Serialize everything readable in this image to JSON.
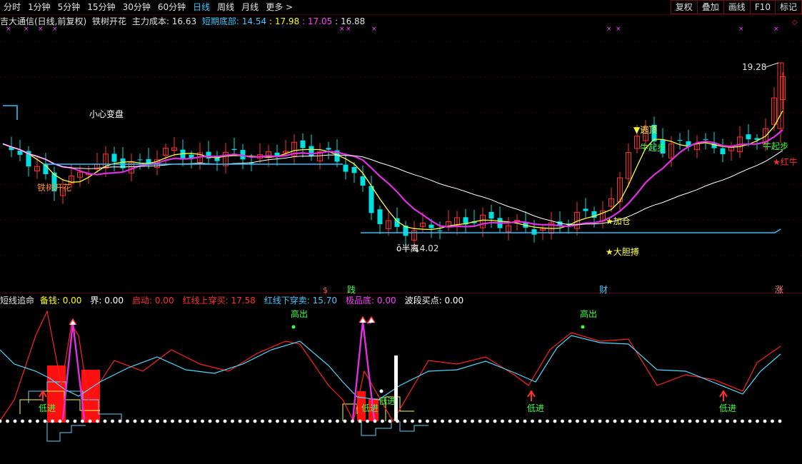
{
  "toolbar": {
    "periods": [
      "分时",
      "1分钟",
      "5分钟",
      "15分钟",
      "30分钟",
      "60分钟",
      "日线",
      "周线",
      "月线",
      "更多 >"
    ],
    "active_period": "日线",
    "buttons": [
      "复权",
      "叠加",
      "画线",
      "F10",
      "标记"
    ]
  },
  "info": {
    "stock": "吉大通信(日线,前复权)",
    "indicator": "铁树开花",
    "main_cost_label": "主力成本:",
    "main_cost": "16.63",
    "short_bottom_label": "短期底部:",
    "v1": "14.54",
    "v2": "17.98",
    "v3": "17.05",
    "v4": "16.88"
  },
  "indicator_line": {
    "name": "短线追命",
    "items": [
      {
        "label": "备钱:",
        "value": "0.00",
        "color": "#ffff00"
      },
      {
        "label": "界:",
        "value": "0.00",
        "color": "#ffffff"
      },
      {
        "label": "启动:",
        "value": "0.00",
        "color": "#ff3030"
      },
      {
        "label": "红线上穿买:",
        "value": "17.58",
        "color": "#ff3030"
      },
      {
        "label": "红线下穿卖:",
        "value": "15.70",
        "color": "#40c8ff"
      },
      {
        "label": "极品底:",
        "value": "0.00",
        "color": "#ff40ff"
      },
      {
        "label": "波段买点:",
        "value": "0.00",
        "color": "#ffffff"
      }
    ]
  },
  "annotations": {
    "price_high": "19.28",
    "price_low": "14.02",
    "careful": "小心变盘",
    "tiezhu": "铁树开花",
    "escape_top": "▼逃顶",
    "niu_start": "牛起步",
    "add_position": "★加仓",
    "bold_bet": "★大胆搏",
    "niu_start2": "牛起步",
    "red_bull": "★红牛",
    "half_price": "ō半离",
    "event_gong": "践",
    "event_cai": "财",
    "event_zhang": "涨",
    "high_out": "高出",
    "low_in": "低进",
    "low_in_2": "低进"
  },
  "chart_data": {
    "type": "candlestick",
    "price_range": [
      13.5,
      19.8
    ],
    "sample_closes": [
      16.9,
      16.7,
      16.2,
      15.6,
      15.8,
      16.2,
      16.5,
      16.4,
      16.3,
      16.6,
      16.8,
      16.6,
      16.5,
      16.7,
      16.6,
      16.5,
      16.7,
      16.9,
      16.8,
      16.7,
      16.4,
      15.8,
      14.6,
      14.3,
      14.2,
      14.3,
      14.4,
      14.5,
      14.6,
      14.5,
      14.4,
      14.3,
      14.2,
      14.5,
      14.7,
      14.8,
      15.1,
      17.1,
      17.4,
      16.8,
      17.0,
      17.1,
      16.8,
      16.9,
      17.2,
      17.4,
      19.28
    ]
  }
}
